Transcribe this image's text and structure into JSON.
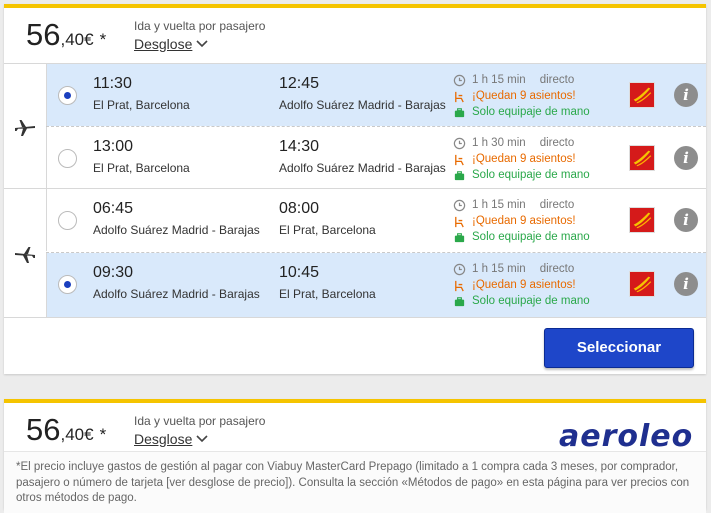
{
  "offer1": {
    "price_int": "56",
    "price_dec": ",40",
    "currency": "€",
    "asterisk": "*",
    "caption": "Ida y vuelta por pasajero",
    "breakdown_label": "Desglose",
    "outbound": [
      {
        "selected": true,
        "dep_time": "11:30",
        "dep_place": "El Prat, Barcelona",
        "arr_time": "12:45",
        "arr_place": "Adolfo Suárez Madrid - Barajas",
        "duration": "1 h 15 min",
        "stops": "directo",
        "seats": "¡Quedan 9 asientos!",
        "baggage": "Solo equipaje de mano"
      },
      {
        "selected": false,
        "dep_time": "13:00",
        "dep_place": "El Prat, Barcelona",
        "arr_time": "14:30",
        "arr_place": "Adolfo Suárez Madrid - Barajas",
        "duration": "1 h 30 min",
        "stops": "directo",
        "seats": "¡Quedan 9 asientos!",
        "baggage": "Solo equipaje de mano"
      }
    ],
    "return": [
      {
        "selected": false,
        "dep_time": "06:45",
        "dep_place": "Adolfo Suárez Madrid - Barajas",
        "arr_time": "08:00",
        "arr_place": "El Prat, Barcelona",
        "duration": "1 h 15 min",
        "stops": "directo",
        "seats": "¡Quedan 9 asientos!",
        "baggage": "Solo equipaje de mano"
      },
      {
        "selected": true,
        "dep_time": "09:30",
        "dep_place": "Adolfo Suárez Madrid - Barajas",
        "arr_time": "10:45",
        "arr_place": "El Prat, Barcelona",
        "duration": "1 h 15 min",
        "stops": "directo",
        "seats": "¡Quedan 9 asientos!",
        "baggage": "Solo equipaje de mano"
      }
    ],
    "select_label": "Seleccionar"
  },
  "offer2": {
    "price_int": "56",
    "price_dec": ",40",
    "currency": "€",
    "asterisk": "*",
    "caption": "Ida y vuelta por pasajero",
    "breakdown_label": "Desglose",
    "logo": "aeroleo",
    "footnote": "*El precio incluye gastos de gestión al pagar con Viabuy MasterCard Prepago (limitado a 1 compra cada 3 meses, por comprador, pasajero o número de tarjeta [ver desglose de precio]). Consulta la sección «Métodos de pago» en esta página para ver precios con otros métodos de pago."
  },
  "icons": {
    "outbound": "plane-takeoff-icon",
    "return": "plane-landing-icon",
    "clock": "clock-icon",
    "seat": "seat-icon",
    "bag": "baggage-icon",
    "airline": "iberia-express-logo",
    "info": "info-icon"
  },
  "colors": {
    "accent_yellow": "#f5c400",
    "selected_row": "#d9e9fb",
    "button_blue": "#1e46c9",
    "seats_orange": "#e86a00",
    "bag_green": "#2aa84a"
  }
}
